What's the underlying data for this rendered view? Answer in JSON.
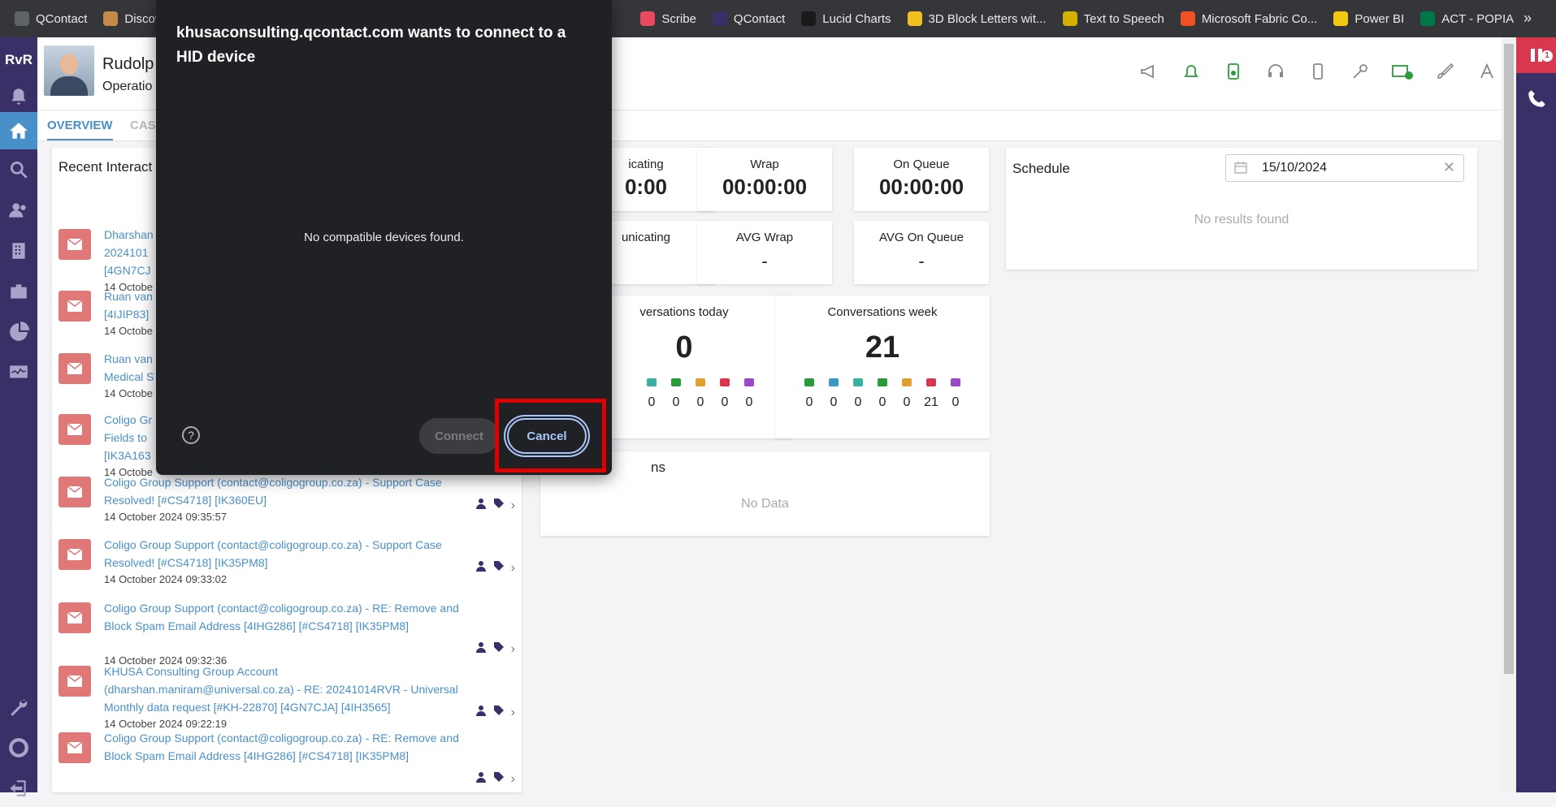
{
  "bookmarks": [
    {
      "label": "QContact",
      "color": "#5f6368"
    },
    {
      "label": "Discov",
      "color": "#c58a4a"
    },
    {
      "label": "Scribe",
      "color": "#e84a5f"
    },
    {
      "label": "QContact",
      "color": "#3a2f66"
    },
    {
      "label": "Lucid Charts",
      "color": "#1a1a1a"
    },
    {
      "label": "3D Block Letters wit...",
      "color": "#f0c020"
    },
    {
      "label": "Text to Speech",
      "color": "#d4b000"
    },
    {
      "label": "Microsoft Fabric Co...",
      "color": "#f25022"
    },
    {
      "label": "Power BI",
      "color": "#f2c811"
    },
    {
      "label": "ACT - POPIA",
      "color": "#007749"
    }
  ],
  "bookmarks_more": "»",
  "nav": {
    "logo": "RvR"
  },
  "rail": {
    "badge": "1"
  },
  "header": {
    "name": "Rudolp",
    "role": "Operatio"
  },
  "tabs": {
    "overview": "OVERVIEW",
    "cases": "CAS"
  },
  "recent": {
    "title": "Recent Interact",
    "items": [
      {
        "subject": "Dharshan\n2024101\n[4GN7CJ",
        "date": "14 Octobe"
      },
      {
        "subject": "Ruan van\n[4IJIP83]",
        "date": "14 Octobe"
      },
      {
        "subject": "Ruan van\nMedical S",
        "date": "14 Octobe"
      },
      {
        "subject": "Coligo Gr\nFields to\n[IK3A163",
        "date": "14 Octobe"
      },
      {
        "subject": "Coligo Group Support (contact@coligogroup.co.za) - Support Case Resolved! [#CS4718] [IK360EU]",
        "date": "14 October 2024 09:35:57"
      },
      {
        "subject": "Coligo Group Support (contact@coligogroup.co.za) - Support Case Resolved! [#CS4718] [IK35PM8]",
        "date": "14 October 2024 09:33:02"
      },
      {
        "subject": "Coligo Group Support (contact@coligogroup.co.za) - RE: Remove and Block Spam Email Address [4IHG286] [#CS4718] [IK35PM8]",
        "date": "14 October 2024 09:32:36"
      },
      {
        "subject": "KHUSA Consulting Group Account (dharshan.maniram@universal.co.za) - RE: 20241014RVR - Universal Monthly data request [#KH-22870] [4GN7CJA] [4IH3565]",
        "date": "14 October 2024 09:22:19"
      },
      {
        "subject": "Coligo Group Support (contact@coligogroup.co.za) - RE: Remove and Block Spam Email Address [4IHG286] [#CS4718] [IK35PM8]",
        "date": ""
      }
    ]
  },
  "stats": {
    "communicating_label": "icating",
    "communicating_value": "0:00",
    "wrap_label": "Wrap",
    "wrap_value": "00:00:00",
    "onqueue_label": "On Queue",
    "onqueue_value": "00:00:00",
    "avg_comm_label": "unicating",
    "avg_wrap_label": "AVG Wrap",
    "avg_wrap_value": "-",
    "avg_onqueue_label": "AVG On Queue",
    "avg_onqueue_value": "-"
  },
  "conv_today": {
    "label": "versations today",
    "total": "0",
    "counts": [
      "0",
      "0",
      "0",
      "0",
      "0"
    ]
  },
  "conv_week": {
    "label": "Conversations week",
    "total": "21",
    "counts": [
      "0",
      "0",
      "0",
      "0",
      "0",
      "21",
      "0"
    ]
  },
  "sessions": {
    "label": "ns",
    "empty": "No Data"
  },
  "schedule": {
    "title": "Schedule",
    "date": "15/10/2024",
    "empty": "No results found"
  },
  "dialog": {
    "title": "khusaconsulting.qcontact.com wants to connect to a HID device",
    "message": "No compatible devices found.",
    "help": "?",
    "connect": "Connect",
    "cancel": "Cancel"
  },
  "colors": {
    "nav": "#3a2f66",
    "accent": "#4a90c8",
    "email": "#e07878",
    "highlight": "#e00000"
  }
}
